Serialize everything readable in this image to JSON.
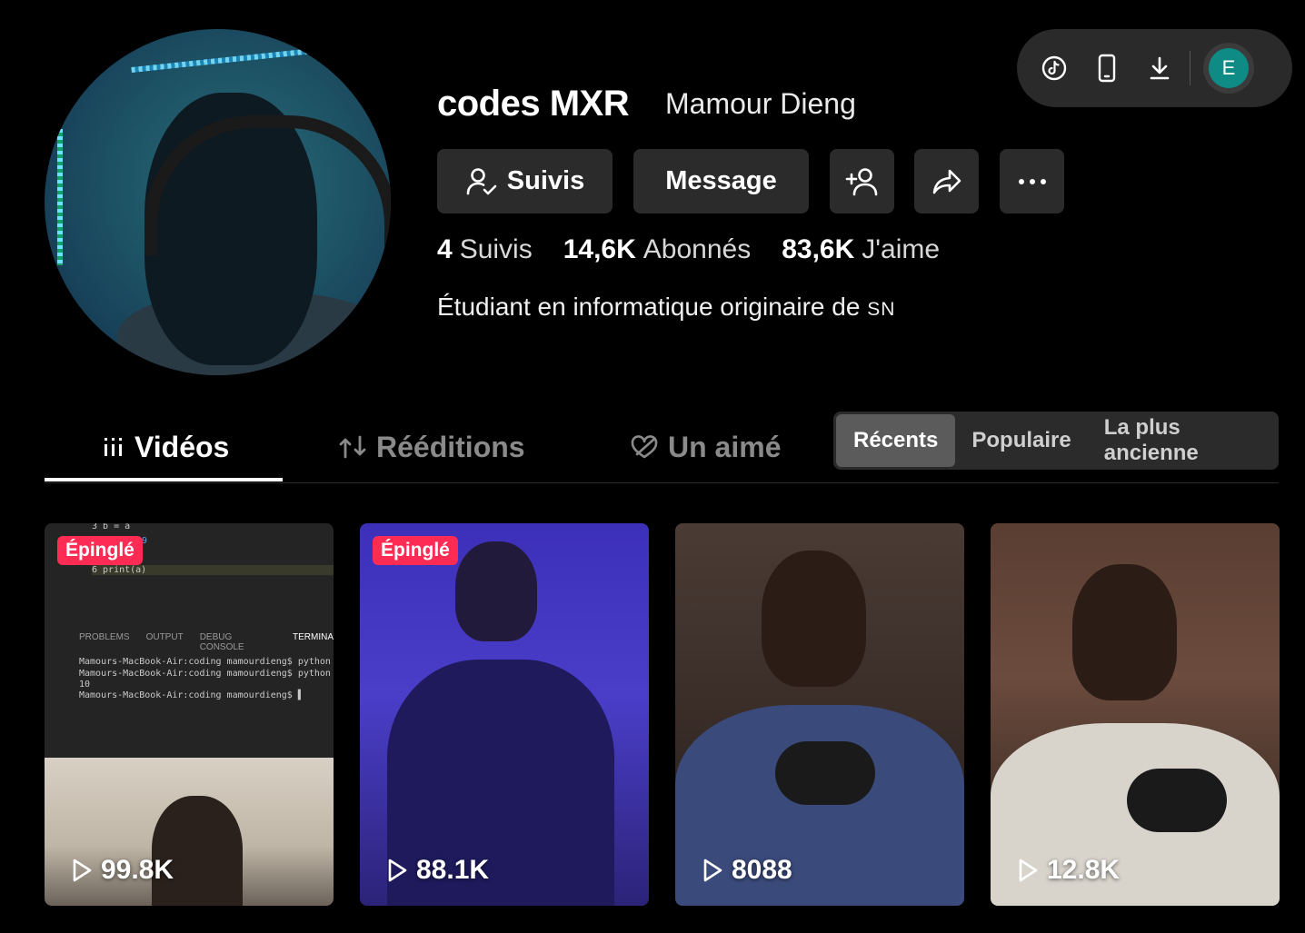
{
  "toolbar": {
    "icons": [
      "tiktok-logo-icon",
      "phone-icon",
      "download-icon"
    ],
    "user_initial": "E"
  },
  "profile": {
    "username": "codes MXR",
    "nickname": "Mamour Dieng",
    "bio_text": "Étudiant en informatique originaire de",
    "bio_country": "SN"
  },
  "actions": {
    "follow_label": "Suivis",
    "message_label": "Message"
  },
  "stats": [
    {
      "value": "4",
      "label": "Suivis"
    },
    {
      "value": "14,6K",
      "label": "Abonnés"
    },
    {
      "value": "83,6K",
      "label": "J'aime"
    }
  ],
  "tabs": {
    "videos": "Vidéos",
    "reposts": "Rééditions",
    "liked": "Un aimé"
  },
  "sort": {
    "options": [
      "Récents",
      "Populaire",
      "La plus ancienne"
    ],
    "selected": "Récents"
  },
  "videos": [
    {
      "views": "99.8K",
      "pinned": "Épinglé"
    },
    {
      "views": "88.1K",
      "pinned": "Épinglé"
    },
    {
      "views": "8088"
    },
    {
      "views": "12.8K"
    }
  ],
  "video1_editor": {
    "line3": "3    b = a",
    "line5": "9",
    "line6": "6    print(a)",
    "panel_tabs": [
      "PROBLEMS",
      "OUTPUT",
      "DEBUG CONSOLE",
      "TERMINA"
    ],
    "terminal": [
      "Mamours-MacBook-Air:coding mamourdieng$ python",
      "Mamours-MacBook-Air:coding mamourdieng$ python",
      "10",
      "Mamours-MacBook-Air:coding mamourdieng$ ▌"
    ]
  },
  "colors": {
    "background": "#000000",
    "button_bg": "#2b2b2b",
    "pinned_badge": "#fe2c55",
    "user_avatar": "#0f8b86"
  }
}
